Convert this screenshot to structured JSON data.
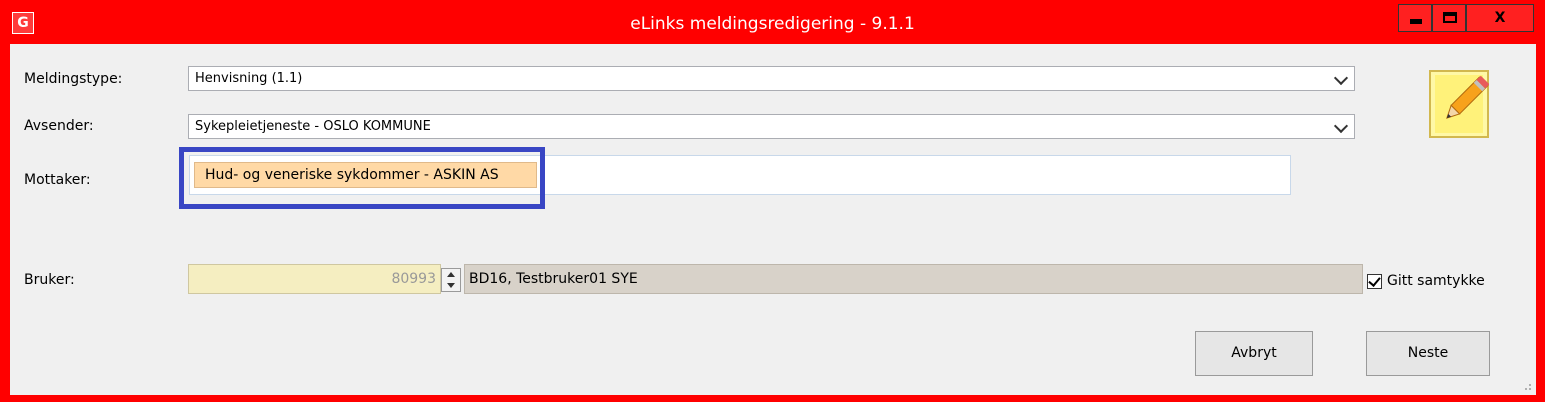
{
  "window": {
    "title": "eLinks meldingsredigering - 9.1.1",
    "app_icon_letter": "G",
    "frame_color": "#ff0000",
    "controls": {
      "minimize": "",
      "maximize": "",
      "close": "X"
    }
  },
  "form": {
    "meldingstype": {
      "label": "Meldingstype:",
      "value": "Henvisning (1.1)"
    },
    "avsender": {
      "label": "Avsender:",
      "value": "Sykepleietjeneste - OSLO KOMMUNE"
    },
    "mottaker": {
      "label": "Mottaker:",
      "token": "Hud- og veneriske sykdommer - ASKIN AS"
    },
    "bruker": {
      "label": "Bruker:",
      "id": "80993",
      "name": "BD16, Testbruker01 SYE"
    },
    "consent": {
      "label": "Gitt samtykke",
      "checked": true
    }
  },
  "buttons": {
    "cancel": "Avbryt",
    "next": "Neste"
  },
  "icons": {
    "edit": "pencil-note-icon"
  },
  "colors": {
    "token_bg": "#ffd9a6",
    "highlight_border": "#3946c4",
    "readonly_user_bg": "#d8d2c9",
    "spin_bg": "#f5eec1"
  }
}
